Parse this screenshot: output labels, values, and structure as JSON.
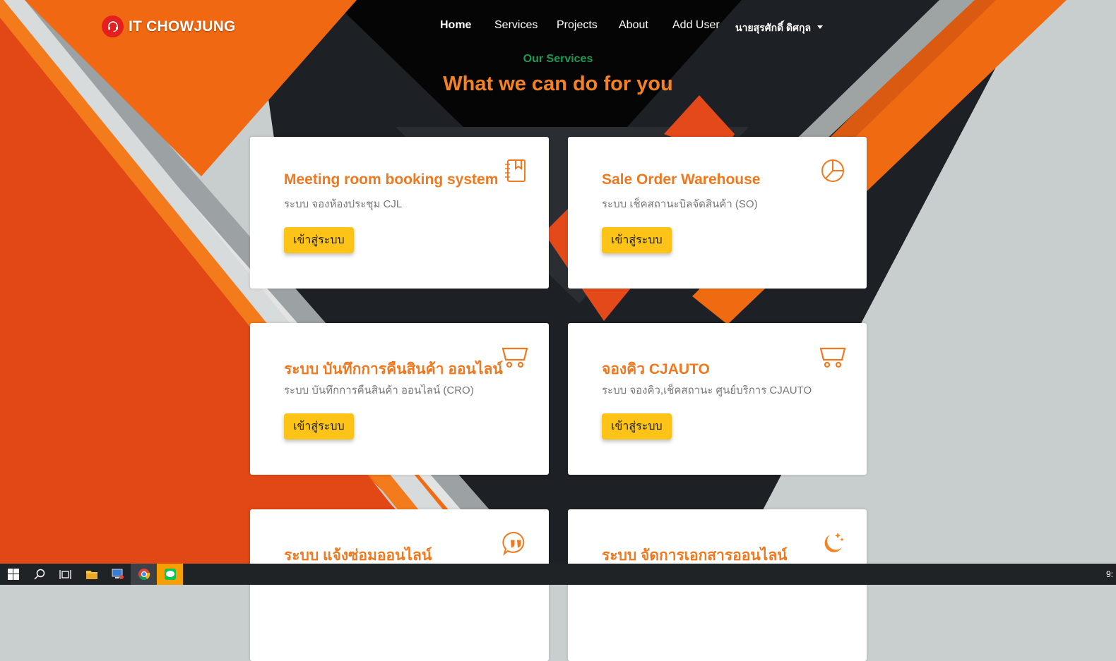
{
  "brand": {
    "name": "IT CHOWJUNG"
  },
  "nav": {
    "items": [
      {
        "label": "Home",
        "active": true
      },
      {
        "label": "Services"
      },
      {
        "label": "Projects"
      },
      {
        "label": "About"
      },
      {
        "label": "Add User"
      }
    ],
    "user": "นายสุรศักดิ์ ดิศกุล"
  },
  "section": {
    "subtitle": "Our Services",
    "title": "What we can do for you"
  },
  "cards": [
    {
      "title": "Meeting room booking system",
      "desc": "ระบบ จองห้องประชุม CJL",
      "button": "เข้าสู่ระบบ",
      "icon": "journal-bookmark-icon"
    },
    {
      "title": "Sale Order Warehouse",
      "desc": "ระบบ เช็คสถานะบิลจัดสินค้า (SO)",
      "button": "เข้าสู่ระบบ",
      "icon": "pie-chart-icon"
    },
    {
      "title": "ระบบ บันทึกการคืนสินค้า ออนไลน์",
      "desc": "ระบบ บันทึกการคืนสินค้า ออนไลน์ (CRO)",
      "button": "เข้าสู่ระบบ",
      "icon": "cart-icon"
    },
    {
      "title": "จองคิว CJAUTO",
      "desc": "ระบบ จองคิว,เช็คสถานะ ศูนย์บริการ CJAUTO",
      "button": "เข้าสู่ระบบ",
      "icon": "cart-icon"
    },
    {
      "title": "ระบบ แจ้งซ่อมออนไลน์",
      "desc": "",
      "button": "",
      "icon": "quote-icon"
    },
    {
      "title": "ระบบ จัดการเอกสารออนไลน์",
      "desc": "",
      "button": "",
      "icon": "moon-stars-icon"
    }
  ],
  "taskbar": {
    "clock": "9:"
  },
  "colors": {
    "accent": "#f58220",
    "button": "#fdc316",
    "subtitle": "#1f9a55"
  }
}
